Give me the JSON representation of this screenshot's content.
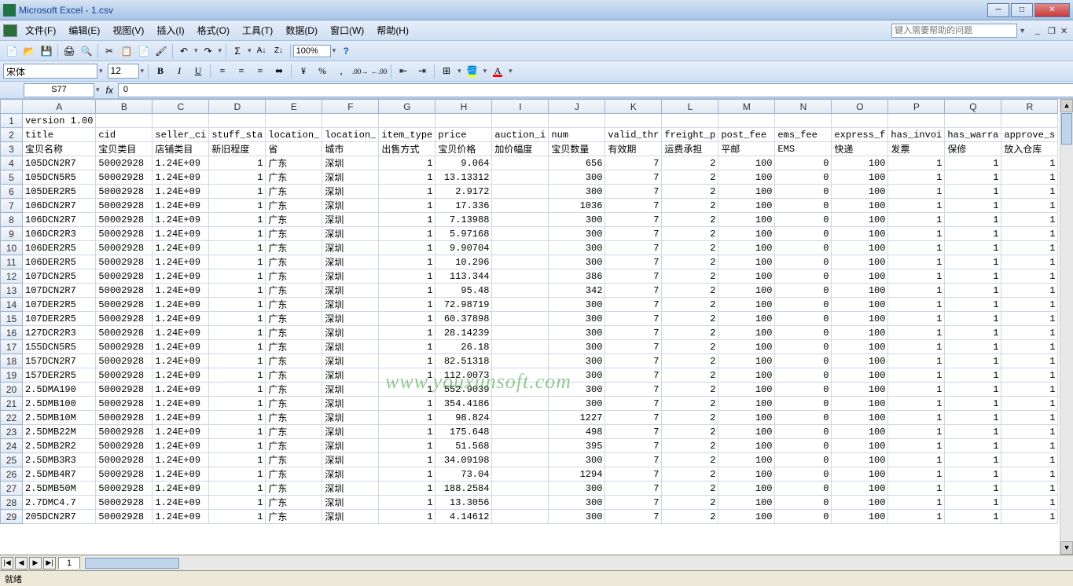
{
  "titlebar": {
    "title": "Microsoft Excel - 1.csv"
  },
  "menu": {
    "file": "文件(F)",
    "edit": "编辑(E)",
    "view": "视图(V)",
    "insert": "插入(I)",
    "format": "格式(O)",
    "tools": "工具(T)",
    "data": "数据(D)",
    "window": "窗口(W)",
    "help": "帮助(H)",
    "helpbox": "键入需要帮助的问题"
  },
  "toolbar": {
    "zoom": "100%"
  },
  "format": {
    "font": "宋体",
    "size": "12"
  },
  "namebox": {
    "cell": "S77",
    "formula": "0"
  },
  "columns": [
    "A",
    "B",
    "C",
    "D",
    "E",
    "F",
    "G",
    "H",
    "I",
    "J",
    "K",
    "L",
    "M",
    "N",
    "O",
    "P",
    "Q",
    "R"
  ],
  "rows": [
    {
      "n": 1,
      "cells": [
        "version 1.00",
        "",
        "",
        "",
        "",
        "",
        "",
        "",
        "",
        "",
        "",
        "",
        "",
        "",
        "",
        "",
        "",
        ""
      ]
    },
    {
      "n": 2,
      "cells": [
        "title",
        "cid",
        "seller_ci",
        "stuff_sta",
        "location_",
        "location_",
        "item_type",
        "price",
        "auction_i",
        "num",
        "valid_thr",
        "freight_p",
        "post_fee",
        "ems_fee",
        "express_f",
        "has_invoi",
        "has_warra",
        "approve_s"
      ]
    },
    {
      "n": 3,
      "cells": [
        "宝贝名称",
        "宝贝类目",
        "店铺类目",
        "新旧程度",
        "省",
        "城市",
        "出售方式",
        "宝贝价格",
        "加价幅度",
        "宝贝数量",
        "有效期",
        "运费承担",
        "平邮",
        "EMS",
        "快递",
        "发票",
        "保修",
        "放入仓库"
      ]
    },
    {
      "n": 4,
      "cells": [
        "105DCN2R7",
        "50002928",
        "1.24E+09",
        "1",
        "广东",
        "深圳",
        "1",
        "9.064",
        "",
        "656",
        "7",
        "2",
        "100",
        "0",
        "100",
        "1",
        "1",
        "1"
      ]
    },
    {
      "n": 5,
      "cells": [
        "105DCN5R5",
        "50002928",
        "1.24E+09",
        "1",
        "广东",
        "深圳",
        "1",
        "13.13312",
        "",
        "300",
        "7",
        "2",
        "100",
        "0",
        "100",
        "1",
        "1",
        "1"
      ]
    },
    {
      "n": 6,
      "cells": [
        "105DER2R5",
        "50002928",
        "1.24E+09",
        "1",
        "广东",
        "深圳",
        "1",
        "2.9172",
        "",
        "300",
        "7",
        "2",
        "100",
        "0",
        "100",
        "1",
        "1",
        "1"
      ]
    },
    {
      "n": 7,
      "cells": [
        "106DCN2R7",
        "50002928",
        "1.24E+09",
        "1",
        "广东",
        "深圳",
        "1",
        "17.336",
        "",
        "1036",
        "7",
        "2",
        "100",
        "0",
        "100",
        "1",
        "1",
        "1"
      ]
    },
    {
      "n": 8,
      "cells": [
        "106DCN2R7",
        "50002928",
        "1.24E+09",
        "1",
        "广东",
        "深圳",
        "1",
        "7.13988",
        "",
        "300",
        "7",
        "2",
        "100",
        "0",
        "100",
        "1",
        "1",
        "1"
      ]
    },
    {
      "n": 9,
      "cells": [
        "106DCR2R3",
        "50002928",
        "1.24E+09",
        "1",
        "广东",
        "深圳",
        "1",
        "5.97168",
        "",
        "300",
        "7",
        "2",
        "100",
        "0",
        "100",
        "1",
        "1",
        "1"
      ]
    },
    {
      "n": 10,
      "cells": [
        "106DER2R5",
        "50002928",
        "1.24E+09",
        "1",
        "广东",
        "深圳",
        "1",
        "9.90704",
        "",
        "300",
        "7",
        "2",
        "100",
        "0",
        "100",
        "1",
        "1",
        "1"
      ]
    },
    {
      "n": 11,
      "cells": [
        "106DER2R5",
        "50002928",
        "1.24E+09",
        "1",
        "广东",
        "深圳",
        "1",
        "10.296",
        "",
        "300",
        "7",
        "2",
        "100",
        "0",
        "100",
        "1",
        "1",
        "1"
      ]
    },
    {
      "n": 12,
      "cells": [
        "107DCN2R5",
        "50002928",
        "1.24E+09",
        "1",
        "广东",
        "深圳",
        "1",
        "113.344",
        "",
        "386",
        "7",
        "2",
        "100",
        "0",
        "100",
        "1",
        "1",
        "1"
      ]
    },
    {
      "n": 13,
      "cells": [
        "107DCN2R7",
        "50002928",
        "1.24E+09",
        "1",
        "广东",
        "深圳",
        "1",
        "95.48",
        "",
        "342",
        "7",
        "2",
        "100",
        "0",
        "100",
        "1",
        "1",
        "1"
      ]
    },
    {
      "n": 14,
      "cells": [
        "107DER2R5",
        "50002928",
        "1.24E+09",
        "1",
        "广东",
        "深圳",
        "1",
        "72.98719",
        "",
        "300",
        "7",
        "2",
        "100",
        "0",
        "100",
        "1",
        "1",
        "1"
      ]
    },
    {
      "n": 15,
      "cells": [
        "107DER2R5",
        "50002928",
        "1.24E+09",
        "1",
        "广东",
        "深圳",
        "1",
        "60.37898",
        "",
        "300",
        "7",
        "2",
        "100",
        "0",
        "100",
        "1",
        "1",
        "1"
      ]
    },
    {
      "n": 16,
      "cells": [
        "127DCR2R3",
        "50002928",
        "1.24E+09",
        "1",
        "广东",
        "深圳",
        "1",
        "28.14239",
        "",
        "300",
        "7",
        "2",
        "100",
        "0",
        "100",
        "1",
        "1",
        "1"
      ]
    },
    {
      "n": 17,
      "cells": [
        "155DCN5R5",
        "50002928",
        "1.24E+09",
        "1",
        "广东",
        "深圳",
        "1",
        "26.18",
        "",
        "300",
        "7",
        "2",
        "100",
        "0",
        "100",
        "1",
        "1",
        "1"
      ]
    },
    {
      "n": 18,
      "cells": [
        "157DCN2R7",
        "50002928",
        "1.24E+09",
        "1",
        "广东",
        "深圳",
        "1",
        "82.51318",
        "",
        "300",
        "7",
        "2",
        "100",
        "0",
        "100",
        "1",
        "1",
        "1"
      ]
    },
    {
      "n": 19,
      "cells": [
        "157DER2R5",
        "50002928",
        "1.24E+09",
        "1",
        "广东",
        "深圳",
        "1",
        "112.0073",
        "",
        "300",
        "7",
        "2",
        "100",
        "0",
        "100",
        "1",
        "1",
        "1"
      ]
    },
    {
      "n": 20,
      "cells": [
        "2.5DMA190",
        "50002928",
        "1.24E+09",
        "1",
        "广东",
        "深圳",
        "1",
        "552.9039",
        "",
        "300",
        "7",
        "2",
        "100",
        "0",
        "100",
        "1",
        "1",
        "1"
      ]
    },
    {
      "n": 21,
      "cells": [
        "2.5DMB100",
        "50002928",
        "1.24E+09",
        "1",
        "广东",
        "深圳",
        "1",
        "354.4186",
        "",
        "300",
        "7",
        "2",
        "100",
        "0",
        "100",
        "1",
        "1",
        "1"
      ]
    },
    {
      "n": 22,
      "cells": [
        "2.5DMB10M",
        "50002928",
        "1.24E+09",
        "1",
        "广东",
        "深圳",
        "1",
        "98.824",
        "",
        "1227",
        "7",
        "2",
        "100",
        "0",
        "100",
        "1",
        "1",
        "1"
      ]
    },
    {
      "n": 23,
      "cells": [
        "2.5DMB22M",
        "50002928",
        "1.24E+09",
        "1",
        "广东",
        "深圳",
        "1",
        "175.648",
        "",
        "498",
        "7",
        "2",
        "100",
        "0",
        "100",
        "1",
        "1",
        "1"
      ]
    },
    {
      "n": 24,
      "cells": [
        "2.5DMB2R2",
        "50002928",
        "1.24E+09",
        "1",
        "广东",
        "深圳",
        "1",
        "51.568",
        "",
        "395",
        "7",
        "2",
        "100",
        "0",
        "100",
        "1",
        "1",
        "1"
      ]
    },
    {
      "n": 25,
      "cells": [
        "2.5DMB3R3",
        "50002928",
        "1.24E+09",
        "1",
        "广东",
        "深圳",
        "1",
        "34.09198",
        "",
        "300",
        "7",
        "2",
        "100",
        "0",
        "100",
        "1",
        "1",
        "1"
      ]
    },
    {
      "n": 26,
      "cells": [
        "2.5DMB4R7",
        "50002928",
        "1.24E+09",
        "1",
        "广东",
        "深圳",
        "1",
        "73.04",
        "",
        "1294",
        "7",
        "2",
        "100",
        "0",
        "100",
        "1",
        "1",
        "1"
      ]
    },
    {
      "n": 27,
      "cells": [
        "2.5DMB50M",
        "50002928",
        "1.24E+09",
        "1",
        "广东",
        "深圳",
        "1",
        "188.2584",
        "",
        "300",
        "7",
        "2",
        "100",
        "0",
        "100",
        "1",
        "1",
        "1"
      ]
    },
    {
      "n": 28,
      "cells": [
        "2.7DMC4.7",
        "50002928",
        "1.24E+09",
        "1",
        "广东",
        "深圳",
        "1",
        "13.3056",
        "",
        "300",
        "7",
        "2",
        "100",
        "0",
        "100",
        "1",
        "1",
        "1"
      ]
    },
    {
      "n": 29,
      "cells": [
        "205DCN2R7",
        "50002928",
        "1.24E+09",
        "1",
        "广东",
        "深圳",
        "1",
        "4.14612",
        "",
        "300",
        "7",
        "2",
        "100",
        "0",
        "100",
        "1",
        "1",
        "1"
      ]
    }
  ],
  "numericCols": [
    3,
    6,
    7,
    9,
    10,
    11,
    12,
    13,
    14,
    15,
    16,
    17
  ],
  "sheet": {
    "tab": "1"
  },
  "status": {
    "ready": "就绪"
  },
  "watermark": "www.youxunsoft.com"
}
